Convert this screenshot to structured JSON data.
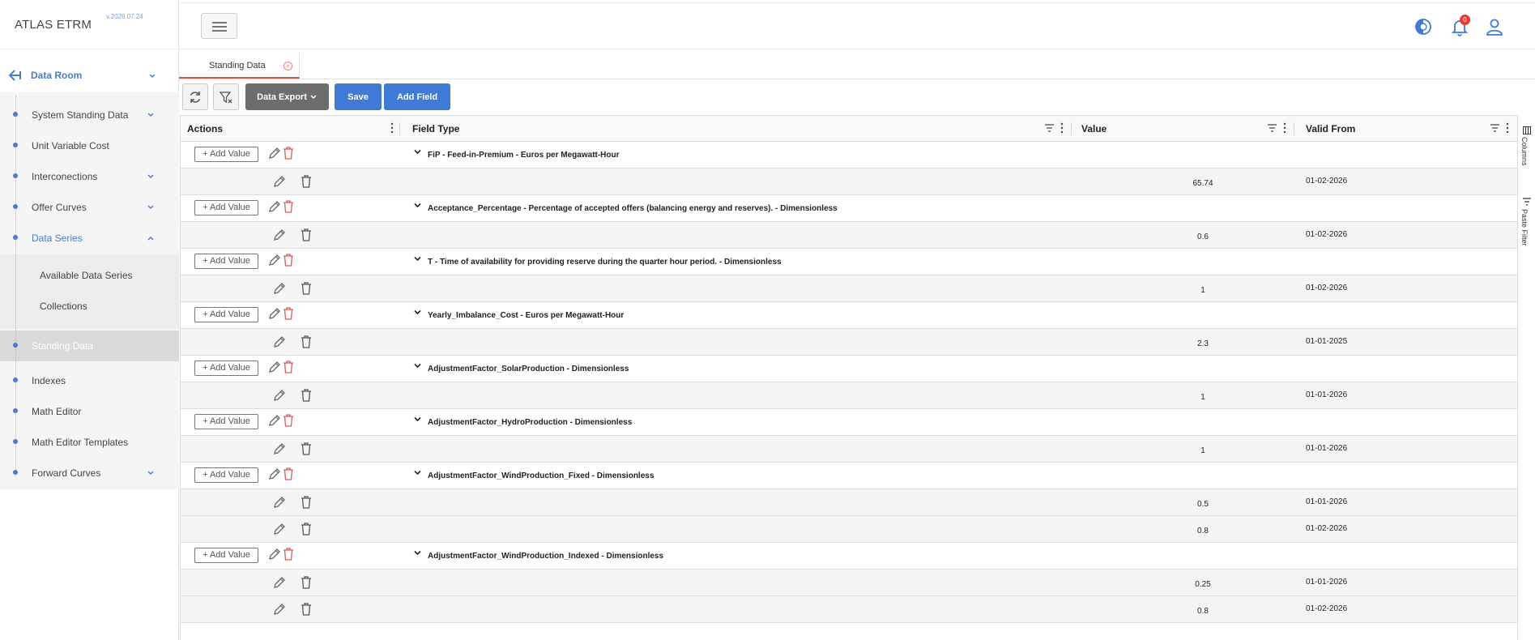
{
  "app": {
    "brand": "ATLAS ETRM",
    "version": "v.2026.07.24"
  },
  "sidebar": {
    "section": "Data Room",
    "items": [
      {
        "label": "System Standing Data",
        "has_children": true
      },
      {
        "label": "Unit Variable Cost",
        "has_children": false
      },
      {
        "label": "Interconections",
        "has_children": true
      },
      {
        "label": "Offer Curves",
        "has_children": true
      },
      {
        "label": "Data Series",
        "has_children": true,
        "expanded": true
      },
      {
        "label": "Standing Data",
        "active": true
      },
      {
        "label": "Indexes"
      },
      {
        "label": "Math Editor"
      },
      {
        "label": "Math Editor Templates"
      },
      {
        "label": "Forward Curves",
        "has_children": true
      }
    ],
    "data_series_children": [
      "Available Data Series",
      "Collections"
    ]
  },
  "header": {
    "notifications_count": "0"
  },
  "tabs": [
    {
      "label": "Standing Data"
    }
  ],
  "toolbar": {
    "data_export": "Data Export",
    "save": "Save",
    "add_field": "Add Field"
  },
  "grid": {
    "columns": {
      "actions": "Actions",
      "field_type": "Field Type",
      "value": "Value",
      "valid_from": "Valid From"
    },
    "add_value_label": "+ Add Value",
    "groups": [
      {
        "field_type": "FiP - Feed-in-Premium - Euros per Megawatt-Hour",
        "rows": [
          {
            "value": "65.74",
            "valid_from": "01-02-2026"
          }
        ]
      },
      {
        "field_type": "Acceptance_Percentage - Percentage of accepted offers (balancing energy and reserves). - Dimensionless",
        "rows": [
          {
            "value": "0.6",
            "valid_from": "01-02-2026"
          }
        ]
      },
      {
        "field_type": "T - Time of availability for providing reserve during the quarter hour period. - Dimensionless",
        "rows": [
          {
            "value": "1",
            "valid_from": "01-02-2026"
          }
        ]
      },
      {
        "field_type": "Yearly_Imbalance_Cost - Euros per Megawatt-Hour",
        "rows": [
          {
            "value": "2.3",
            "valid_from": "01-01-2025"
          }
        ]
      },
      {
        "field_type": "AdjustmentFactor_SolarProduction - Dimensionless",
        "rows": [
          {
            "value": "1",
            "valid_from": "01-01-2026"
          }
        ]
      },
      {
        "field_type": "AdjustmentFactor_HydroProduction - Dimensionless",
        "rows": [
          {
            "value": "1",
            "valid_from": "01-01-2026"
          }
        ]
      },
      {
        "field_type": "AdjustmentFactor_WindProduction_Fixed - Dimensionless",
        "rows": [
          {
            "value": "0.5",
            "valid_from": "01-01-2026"
          },
          {
            "value": "0.8",
            "valid_from": "01-02-2026"
          }
        ]
      },
      {
        "field_type": "AdjustmentFactor_WindProduction_Indexed - Dimensionless",
        "rows": [
          {
            "value": "0.25",
            "valid_from": "01-01-2026"
          },
          {
            "value": "0.8",
            "valid_from": "01-02-2026"
          }
        ]
      }
    ]
  },
  "side_panel": {
    "columns": "Columns",
    "paste_filter": "Paste Filter"
  },
  "colors": {
    "accent": "#4a7cc9",
    "primary_button": "#3f7ad6",
    "secondary_button": "#6d6d6d",
    "delete_icon": "#e05a5a",
    "badge": "#e53935"
  },
  "icons": {
    "back": "arrow-left-icon",
    "menu": "hamburger-icon",
    "theme": "contrast-icon",
    "notifications": "bell-icon",
    "user": "user-icon",
    "refresh": "refresh-icon",
    "clear_filter": "filter-clear-icon",
    "edit": "pencil-icon",
    "delete": "trash-icon"
  }
}
